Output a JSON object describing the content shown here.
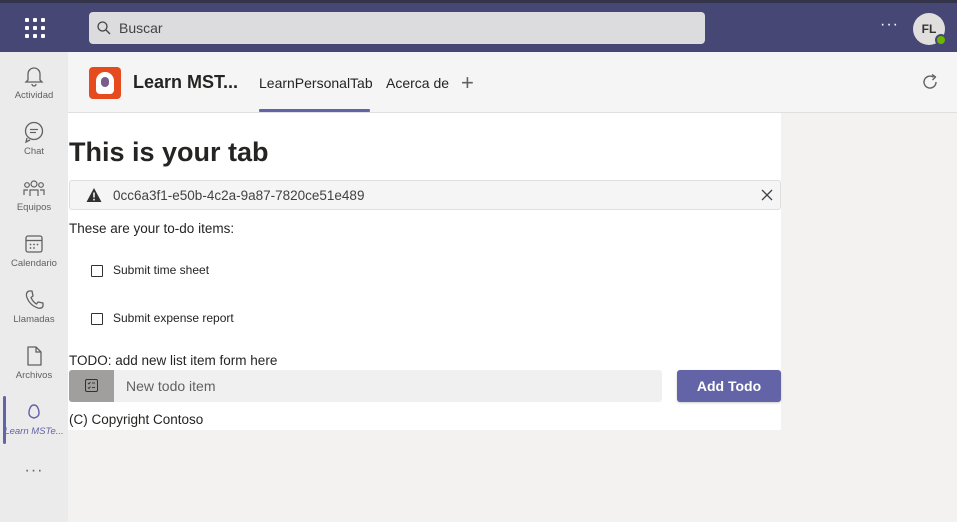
{
  "topbar": {
    "search_placeholder": "Buscar",
    "more_label": "···",
    "avatar_initials": "FL"
  },
  "rail": {
    "items": [
      {
        "label": "Actividad",
        "icon": "bell-icon"
      },
      {
        "label": "Chat",
        "icon": "chat-icon"
      },
      {
        "label": "Equipos",
        "icon": "teams-icon"
      },
      {
        "label": "Calendario",
        "icon": "calendar-icon"
      },
      {
        "label": "Llamadas",
        "icon": "phone-icon"
      },
      {
        "label": "Archivos",
        "icon": "file-icon"
      },
      {
        "label": "Learn MSTe...",
        "icon": "app-icon"
      }
    ],
    "more_label": "···"
  },
  "app": {
    "title": "Learn MST...",
    "tabs": [
      {
        "label": "LearnPersonalTab"
      },
      {
        "label": "Acerca de"
      }
    ],
    "add_tab_label": "+"
  },
  "content": {
    "heading": "This is your tab",
    "alert_text": "0cc6a3f1-e50b-4c2a-9a87-7820ce51e489",
    "intro": "These are your to-do items:",
    "todos": [
      {
        "label": "Submit time sheet",
        "checked": false
      },
      {
        "label": "Submit expense report",
        "checked": false
      }
    ],
    "todo_note": "TODO: add new list item form here",
    "input_placeholder": "New todo item",
    "add_button_label": "Add Todo",
    "copyright": "(C) Copyright Contoso"
  },
  "colors": {
    "topbar": "#464775",
    "accent": "#6264a7",
    "app_logo": "#e64b1f",
    "presence": "#6bb700"
  }
}
